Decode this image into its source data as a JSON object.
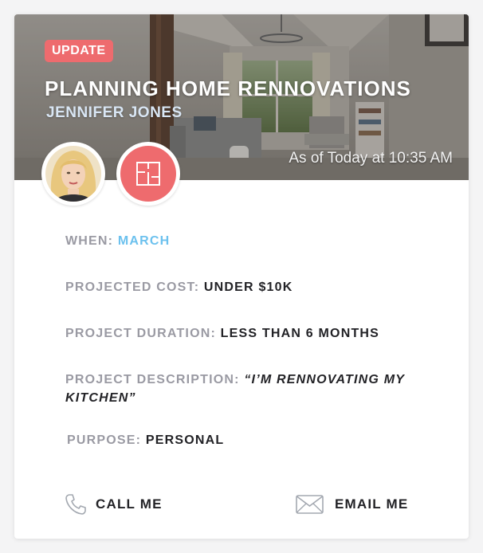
{
  "header": {
    "badge": "UPDATE",
    "title": "PLANNING HOME RENNOVATIONS",
    "author": "JENNIFER JONES",
    "timestamp": "As of Today at 10:35 AM"
  },
  "details": {
    "when": {
      "label": "WHEN:",
      "value": "MARCH"
    },
    "cost": {
      "label": "PROJECTED COST:",
      "value": "UNDER $10K"
    },
    "duration": {
      "label": "PROJECT DURATION:",
      "value": "LESS THAN 6 MONTHS"
    },
    "description": {
      "label": "PROJECT DESCRIPTION:",
      "value": "“I’M RENNOVATING MY KITCHEN”"
    },
    "purpose": {
      "label": "PURPOSE:",
      "value": "PERSONAL"
    }
  },
  "actions": {
    "call": {
      "label": "CALL ME",
      "icon": "phone-icon"
    },
    "email": {
      "label": "EMAIL ME",
      "icon": "envelope-icon"
    }
  },
  "colors": {
    "accent": "#ee6b6e",
    "link_blue": "#6cc1ee",
    "label_gray": "#9a9aa3",
    "value_dark": "#222226"
  }
}
